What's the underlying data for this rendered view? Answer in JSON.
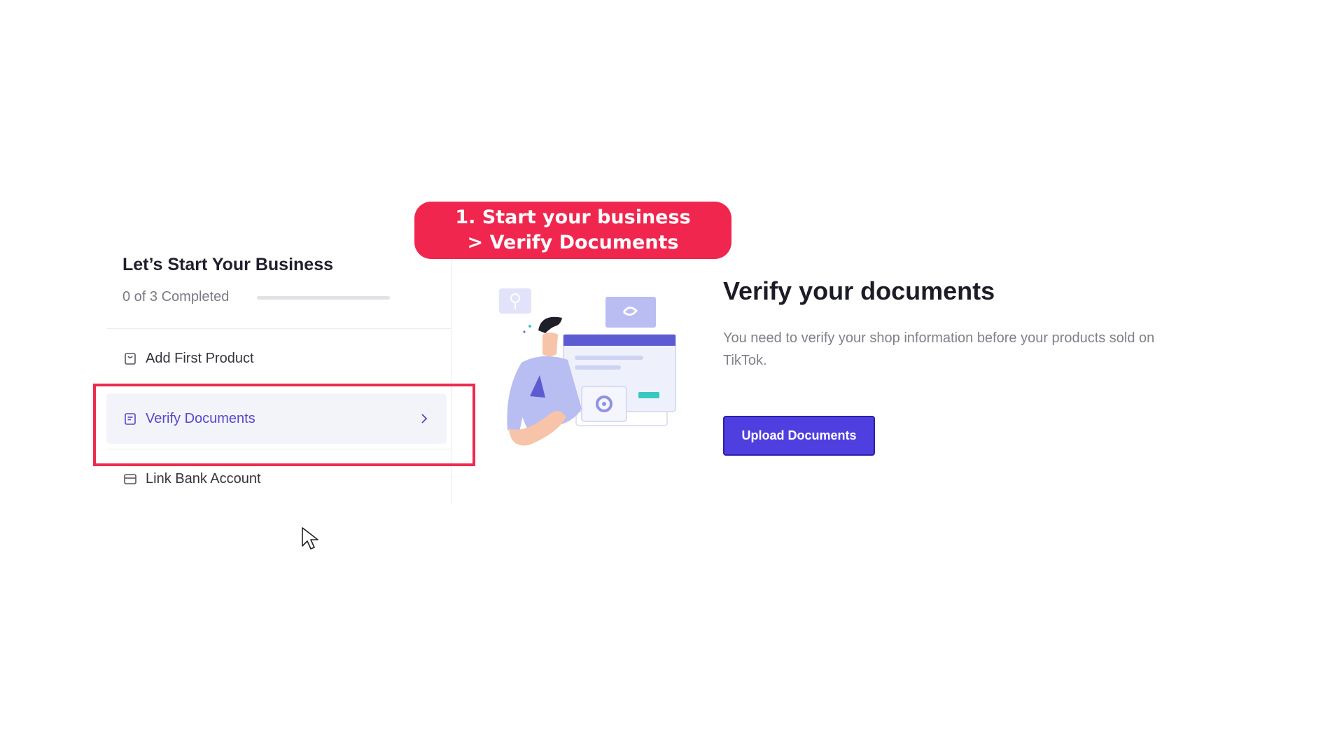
{
  "callout": {
    "line1": "1. Start your business",
    "line2": "> Verify Documents"
  },
  "panel": {
    "title": "Let’s Start Your Business",
    "progress_text": "0 of 3 Completed",
    "progress_fraction": 0,
    "tasks": [
      {
        "label": "Add First Product",
        "icon": "shopping-bag-icon"
      },
      {
        "label": "Verify Documents",
        "icon": "document-icon",
        "active": true
      },
      {
        "label": "Link Bank Account",
        "icon": "credit-card-icon"
      }
    ]
  },
  "content": {
    "heading": "Verify your documents",
    "description": "You need to verify your shop information before your products sold on TikTok.",
    "button_label": "Upload Documents"
  },
  "colors": {
    "callout": "#f0264f",
    "highlight": "#ee2b4f",
    "accent": "#4f3fe0"
  }
}
